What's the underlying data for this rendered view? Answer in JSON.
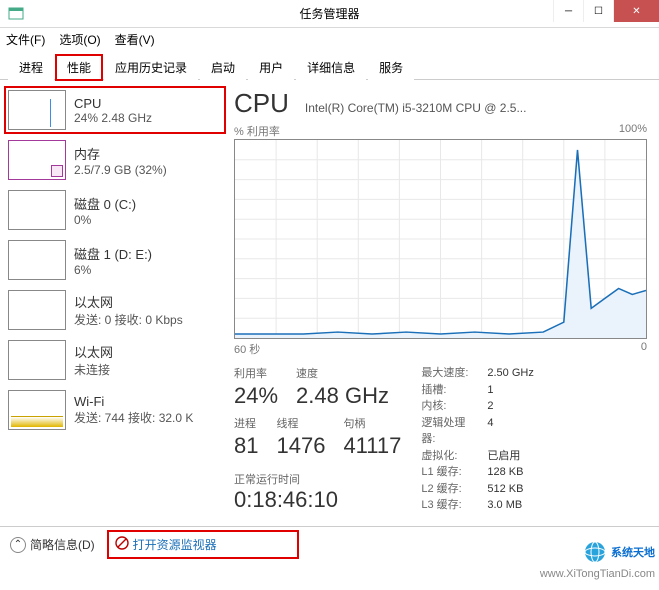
{
  "window": {
    "title": "任务管理器"
  },
  "menu": {
    "file": "文件(F)",
    "options": "选项(O)",
    "view": "查看(V)"
  },
  "tabs": {
    "processes": "进程",
    "performance": "性能",
    "history": "应用历史记录",
    "startup": "启动",
    "users": "用户",
    "details": "详细信息",
    "services": "服务"
  },
  "sidebar": [
    {
      "name": "CPU",
      "sub": "24%  2.48 GHz"
    },
    {
      "name": "内存",
      "sub": "2.5/7.9 GB (32%)"
    },
    {
      "name": "磁盘 0 (C:)",
      "sub": "0%"
    },
    {
      "name": "磁盘 1 (D: E:)",
      "sub": "6%"
    },
    {
      "name": "以太网",
      "sub": "发送: 0 接收: 0 Kbps"
    },
    {
      "name": "以太网",
      "sub": "未连接"
    },
    {
      "name": "Wi-Fi",
      "sub": "发送: 744 接收: 32.0 K"
    }
  ],
  "main": {
    "title": "CPU",
    "model": "Intel(R) Core(TM) i5-3210M CPU @ 2.5...",
    "chart_top_left": "% 利用率",
    "chart_top_right": "100%",
    "chart_bottom_left": "60 秒",
    "chart_bottom_right": "0",
    "stats": {
      "util_lbl": "利用率",
      "util_val": "24%",
      "speed_lbl": "速度",
      "speed_val": "2.48 GHz",
      "proc_lbl": "进程",
      "proc_val": "81",
      "thread_lbl": "线程",
      "thread_val": "1476",
      "handle_lbl": "句柄",
      "handle_val": "41117"
    },
    "specs": [
      {
        "k": "最大速度:",
        "v": "2.50 GHz"
      },
      {
        "k": "插槽:",
        "v": "1"
      },
      {
        "k": "内核:",
        "v": "2"
      },
      {
        "k": "逻辑处理器:",
        "v": "4"
      },
      {
        "k": "虚拟化:",
        "v": "已启用"
      },
      {
        "k": "L1 缓存:",
        "v": "128 KB"
      },
      {
        "k": "L2 缓存:",
        "v": "512 KB"
      },
      {
        "k": "L3 缓存:",
        "v": "3.0 MB"
      }
    ],
    "uptime_lbl": "正常运行时间",
    "uptime_val": "0:18:46:10"
  },
  "bottom": {
    "less": "简略信息(D)",
    "resmon": "打开资源监视器"
  },
  "watermark": {
    "brand": "系统天地",
    "url": "www.XiTongTianDi.com"
  },
  "chart_data": {
    "type": "line",
    "title": "% 利用率",
    "xlabel": "60 秒",
    "ylabel": "",
    "ylim": [
      0,
      100
    ],
    "x_seconds_ago": [
      60,
      55,
      50,
      45,
      40,
      35,
      30,
      25,
      20,
      15,
      12,
      10,
      8,
      6,
      4,
      2,
      0
    ],
    "values": [
      2,
      2,
      2,
      3,
      2,
      3,
      2,
      3,
      2,
      3,
      8,
      95,
      15,
      20,
      25,
      22,
      24
    ]
  }
}
